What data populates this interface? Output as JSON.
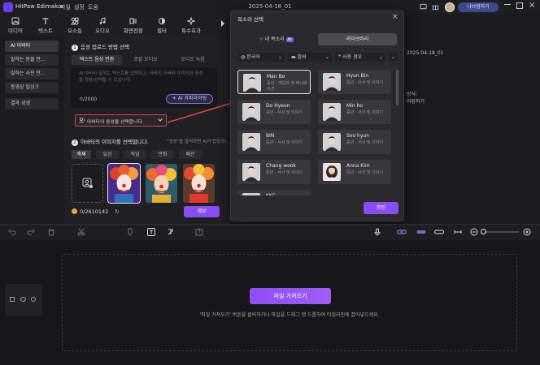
{
  "app": {
    "name": "HitPaw Edimakor",
    "menu": [
      "파일",
      "설정",
      "도움"
    ],
    "doc_title": "2025-04-18_01",
    "upgrade_label": "나브업하기",
    "accent": "#8b4df2"
  },
  "toolbar": {
    "tools": [
      {
        "label": "미디어",
        "icon": "media-icon"
      },
      {
        "label": "텍스트",
        "icon": "text-icon"
      },
      {
        "label": "요소들",
        "icon": "elements-icon"
      },
      {
        "label": "오디오",
        "icon": "audio-icon"
      },
      {
        "label": "화면전환",
        "icon": "transition-icon"
      },
      {
        "label": "필터",
        "icon": "filter-icon"
      },
      {
        "label": "특수효과",
        "icon": "effects-icon"
      }
    ]
  },
  "sidebar": {
    "items": [
      "AI 아바타",
      "말하는 동물 만...",
      "말하는 사진 만...",
      "동영상 립싱크",
      "결과 성생"
    ]
  },
  "panel": {
    "step1_num": "1",
    "step1_title": "음성 업로드 방법 선택",
    "subtabs": [
      "텍스트 음성 변환",
      "로컬 오디오",
      "오디오 녹음"
    ],
    "placeholder": "AI 아바타 말하는 텍스트를 입력하고, 아래의 아바타 이미지와 음성을 생성/선택할 수 있습니다.",
    "char_count": "0/2000",
    "ai_btn_label": "AI 카피라이팅",
    "voice_select_label": "아바타의 음성을 선택합니다.",
    "step2_num": "2",
    "step2_title": "아바타의 이미지를 선택합니다.",
    "step2_hint": "\"생성\"을 클릭하면 AI가 립싱크된",
    "filters": [
      "축제",
      "일상",
      "직업",
      "만화",
      "패션"
    ],
    "credits": "0/2610142",
    "generate_label": "생성"
  },
  "preview": {
    "lines": [
      "2025-04-18_01",
      "방식:",
      "저장하기"
    ]
  },
  "modal": {
    "title": "목소리 선택",
    "tab_my": "내 목소리",
    "tab_my_badge": "AI",
    "tab_library": "라이브러리",
    "filters": [
      "한국어",
      "말씨",
      "사용 경우"
    ],
    "voices": [
      {
        "name": "Man Bo",
        "desc": "중년 - 게임과 및 애니메이션",
        "gender": "m",
        "selected": true
      },
      {
        "name": "Hyun Bin",
        "desc": "중년 - 서사 및 이야기",
        "gender": "m",
        "selected": false
      },
      {
        "name": "Do Hyeon",
        "desc": "중년 - 서사 및 이야기",
        "gender": "m",
        "selected": false
      },
      {
        "name": "Min ho",
        "desc": "중년 - 서사 및 이야기",
        "gender": "m",
        "selected": false
      },
      {
        "name": "BIN",
        "desc": "중년 - 서사 및 이야기",
        "gender": "m",
        "selected": false
      },
      {
        "name": "Soo hyun",
        "desc": "중년 - 서사 및 이야기",
        "gender": "m",
        "selected": false
      },
      {
        "name": "Chang wook",
        "desc": "중년 - 서사 및 이야기",
        "gender": "m",
        "selected": false
      },
      {
        "name": "Anna Kim",
        "desc": "중년 - 서사 및 이야기",
        "gender": "f",
        "selected": false
      },
      {
        "name": "KKC",
        "desc": "",
        "gender": "m",
        "selected": false
      }
    ],
    "confirm_label": "확인"
  },
  "timeline": {
    "import_label": "파일 가져오기",
    "drop_hint": "'파일 가져오기' 버튼을 클릭하거나 파일을 드래그 앤 드롭하여 타임라인에 끌어넣으세요."
  }
}
